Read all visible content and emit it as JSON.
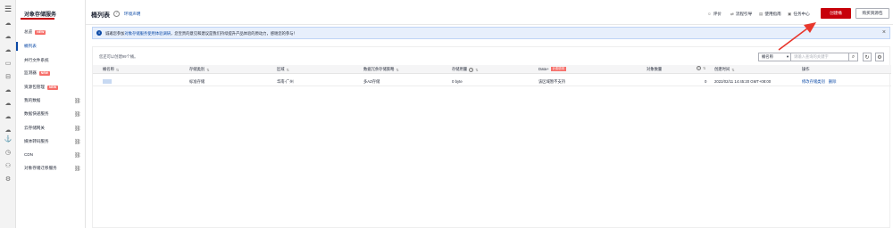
{
  "sidebar": {
    "title": "对象存储服务",
    "items": [
      {
        "label": "总览",
        "badge": "NEW"
      },
      {
        "label": "桶列表",
        "badge": ""
      },
      {
        "label": "并行文件系统",
        "badge": ""
      },
      {
        "label": "监测器",
        "badge": "NEW"
      },
      {
        "label": "资源包管理",
        "badge": "NEW"
      },
      {
        "label": "我的数据",
        "badge": ""
      },
      {
        "label": "数据快递服务",
        "badge": ""
      },
      {
        "label": "云存储网关",
        "badge": ""
      },
      {
        "label": "媒体转码服务",
        "badge": ""
      },
      {
        "label": "CDN",
        "badge": ""
      },
      {
        "label": "对象存储迁移服务",
        "badge": ""
      }
    ]
  },
  "header": {
    "title": "桶列表",
    "notice_link": "环境声明",
    "links": [
      {
        "label": "评价",
        "icon": "smile-icon"
      },
      {
        "label": "流程引导",
        "icon": "flow-icon"
      },
      {
        "label": "使用指南",
        "icon": "book-icon"
      },
      {
        "label": "任务中心",
        "icon": "task-icon"
      }
    ],
    "primary_button": "创建桶",
    "secondary_button": "购买资源包"
  },
  "banner": {
    "prefix": "诚邀您参加",
    "link": "对象存储服务使用体验调研",
    "suffix": "，您宝贵的意见和建议是我们持续提升产品体验的原动力，感谢您的参与！"
  },
  "toolbar": {
    "count_text": "您还可以创建99个桶。",
    "filter_value": "桶名称",
    "search_placeholder": "请输入查询的关键字"
  },
  "table": {
    "columns": [
      "桶名称",
      "存储类别",
      "区域",
      "数据冗余存储策略",
      "存储用量",
      "Data+",
      "对象数量",
      "创建时间",
      "操作"
    ],
    "data_badge": "计费说明",
    "rows": [
      {
        "name": "",
        "storage_class": "标准存储",
        "region": "华南-广州",
        "redundancy": "多AZ存储",
        "usage": "0 byte",
        "data_plus": "该区域暂不支持",
        "objects": "0",
        "created": "2022/02/11 14:45:20 GMT+08:00",
        "ops": [
          "修改存储类别",
          "删除"
        ]
      }
    ]
  },
  "colors": {
    "accent": "#c7000b",
    "link": "#0a49a6",
    "banner_bg": "#e7effc",
    "arrow": "#e8362c"
  }
}
